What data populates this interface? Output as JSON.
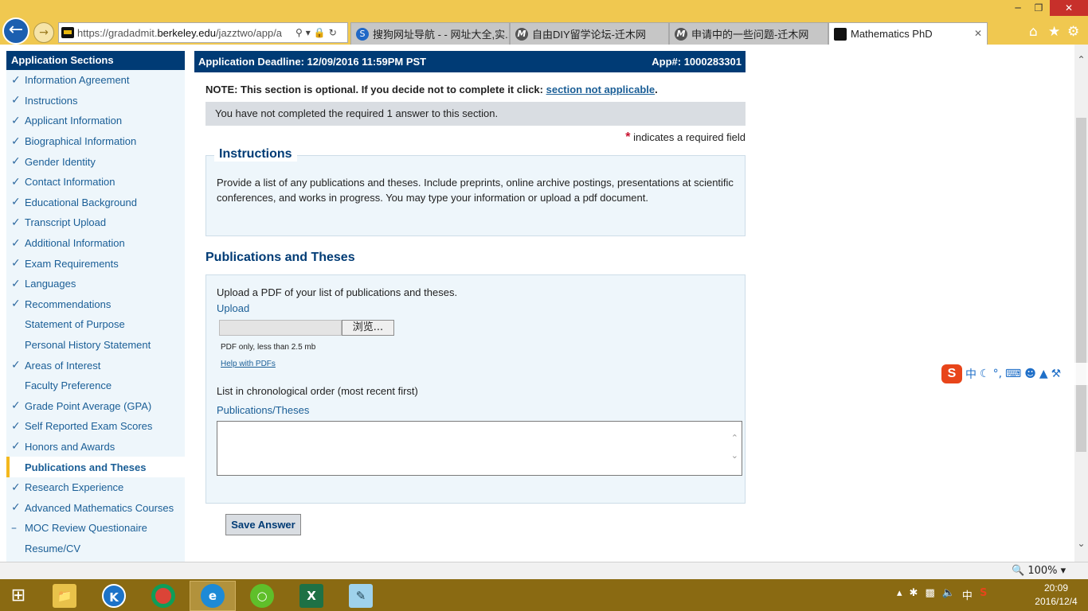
{
  "browser": {
    "url_prefix": "https://gradadmit.",
    "url_domain": "berkeley.edu",
    "url_suffix": "/jazztwo/app/a",
    "tabs": [
      {
        "label": "搜狗网址导航 - - 网址大全,实..."
      },
      {
        "label": "自由DIY留学论坛-迁木网"
      },
      {
        "label": "申请中的一些问题-迁木网"
      },
      {
        "label": "Mathematics PhD"
      }
    ],
    "zoom": "100%"
  },
  "sidebar": {
    "title": "Application Sections",
    "items": [
      {
        "label": "Information Agreement",
        "status": "done"
      },
      {
        "label": "Instructions",
        "status": "done"
      },
      {
        "label": "Applicant Information",
        "status": "done"
      },
      {
        "label": "Biographical Information",
        "status": "done"
      },
      {
        "label": "Gender Identity",
        "status": "done"
      },
      {
        "label": "Contact Information",
        "status": "done"
      },
      {
        "label": "Educational Background",
        "status": "done"
      },
      {
        "label": "Transcript Upload",
        "status": "done"
      },
      {
        "label": "Additional Information",
        "status": "done"
      },
      {
        "label": "Exam Requirements",
        "status": "done"
      },
      {
        "label": "Languages",
        "status": "done"
      },
      {
        "label": "Recommendations",
        "status": "done"
      },
      {
        "label": "Statement of Purpose",
        "status": "none"
      },
      {
        "label": "Personal History Statement",
        "status": "none"
      },
      {
        "label": "Areas of Interest",
        "status": "done"
      },
      {
        "label": "Faculty Preference",
        "status": "none"
      },
      {
        "label": "Grade Point Average (GPA)",
        "status": "done"
      },
      {
        "label": "Self Reported Exam Scores",
        "status": "done"
      },
      {
        "label": "Honors and Awards",
        "status": "done"
      },
      {
        "label": "Publications and Theses",
        "status": "active"
      },
      {
        "label": "Research Experience",
        "status": "done"
      },
      {
        "label": "Advanced Mathematics Courses",
        "status": "done"
      },
      {
        "label": "MOC Review Questionaire",
        "status": "partial"
      },
      {
        "label": "Resume/CV",
        "status": "none"
      }
    ]
  },
  "main": {
    "deadline": "Application Deadline: 12/09/2016 11:59PM PST",
    "app_number": "App#: 1000283301",
    "note_prefix": "NOTE: This section is optional. If you decide not to complete it click: ",
    "note_link": "section not applicable",
    "note_suffix": ".",
    "incomplete_message": "You have not completed the required 1 answer to this section.",
    "required_star": "*",
    "required_note": "indicates a required field",
    "instructions_title": "Instructions",
    "instructions_text": "Provide a list of any publications and theses. Include preprints, online archive postings, presentations at scientific conferences, and works in progress. You may type your information or upload a pdf document.",
    "section_title": "Publications and Theses",
    "upload_prompt": "Upload a PDF of your list of publications and theses.",
    "upload_label": "Upload",
    "browse_button": "浏览...",
    "pdf_limit": "PDF only, less than 2.5 mb",
    "help_link": "Help with PDFs",
    "order_note": "List in chronological order (most recent first)",
    "textarea_label": "Publications/Theses",
    "textarea_value": "",
    "save_button": "Save Answer"
  },
  "taskbar": {
    "time": "20:09",
    "date": "2016/12/4",
    "ime_lang": "中"
  },
  "colors": {
    "navy": "#003b75",
    "link": "#1a5e96",
    "panel": "#eef6fb",
    "active_marker": "#f4b81d",
    "required": "#c8102e",
    "chrome": "#f0c850",
    "taskbar": "#8a6a12"
  }
}
